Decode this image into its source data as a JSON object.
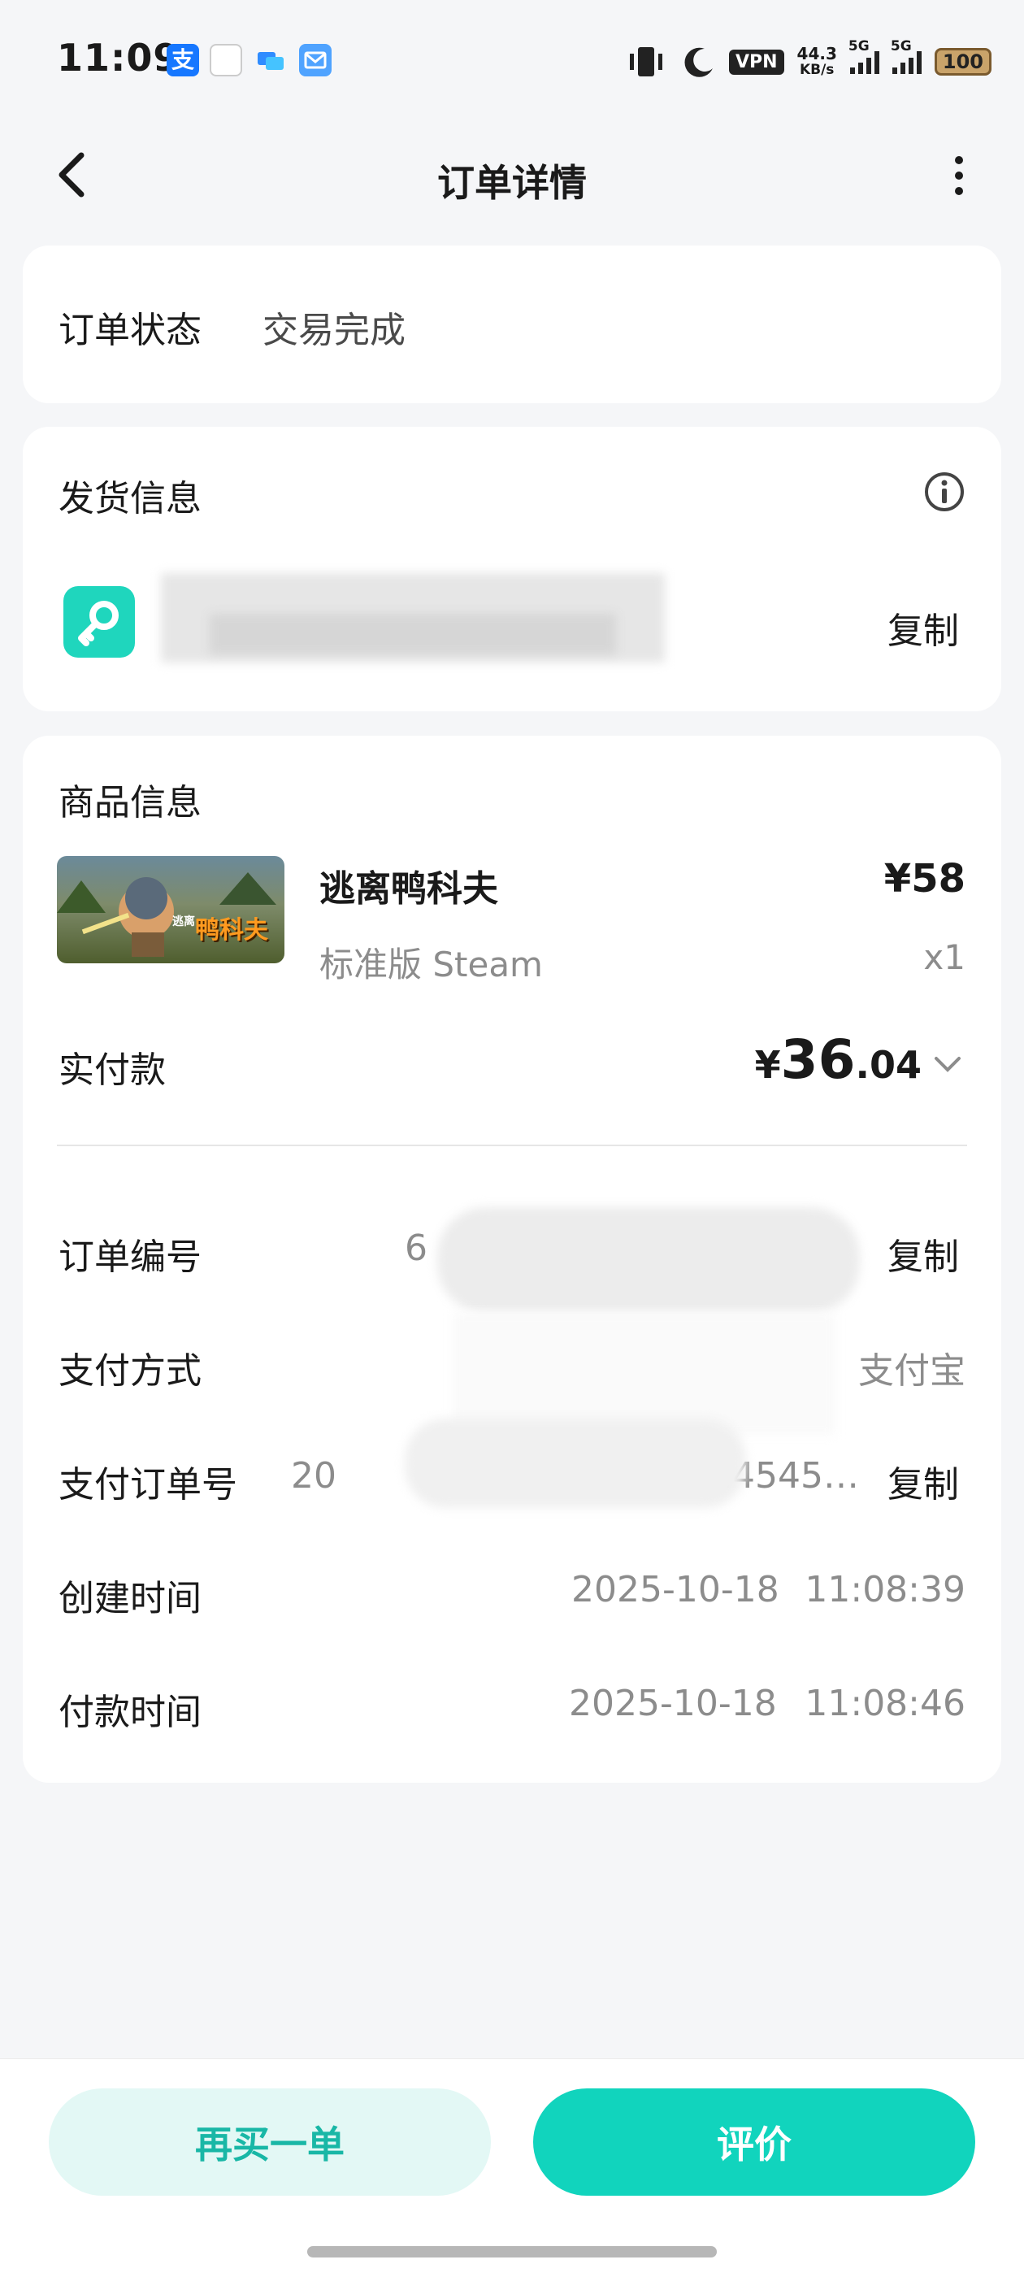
{
  "status_bar": {
    "time": "11:09",
    "vpn": "VPN",
    "net_speed_value": "44.3",
    "net_speed_unit": "KB/s",
    "signal1_label": "5G",
    "signal2_label": "5G",
    "battery": "100",
    "icons": [
      "alipay-icon",
      "app-icon",
      "cloud-icon",
      "mail-icon",
      "vibrate-icon",
      "moon-icon"
    ]
  },
  "header": {
    "title": "订单详情"
  },
  "order_status": {
    "label": "订单状态",
    "value": "交易完成"
  },
  "shipping": {
    "title": "发货信息",
    "copy_label": "复制"
  },
  "product": {
    "section_title": "商品信息",
    "name": "逃离鸭科夫",
    "variant": "标准版 Steam",
    "price": "¥58",
    "quantity": "x1",
    "thumb_text": "鸭科夫",
    "thumb_prefix": "逃离"
  },
  "payment": {
    "label": "实付款",
    "currency": "¥",
    "amount_int": "36",
    "amount_dec": ".04"
  },
  "details": {
    "order_no_label": "订单编号",
    "order_no_value": "6",
    "order_no_copy": "复制",
    "pay_method_label": "支付方式",
    "pay_method_value": "支付宝",
    "pay_order_label": "支付订单号",
    "pay_order_value_start": "20",
    "pay_order_value_end": "4252014545…",
    "pay_order_copy": "复制",
    "created_label": "创建时间",
    "created_date": "2025-10-18",
    "created_time": "11:08:39",
    "paid_label": "付款时间",
    "paid_date": "2025-10-18",
    "paid_time": "11:08:46"
  },
  "actions": {
    "rebuy": "再买一单",
    "review": "评价"
  },
  "colors": {
    "accent": "#11d4bd",
    "accent_light": "#e3f8f5",
    "accent_text": "#19b7a6"
  }
}
